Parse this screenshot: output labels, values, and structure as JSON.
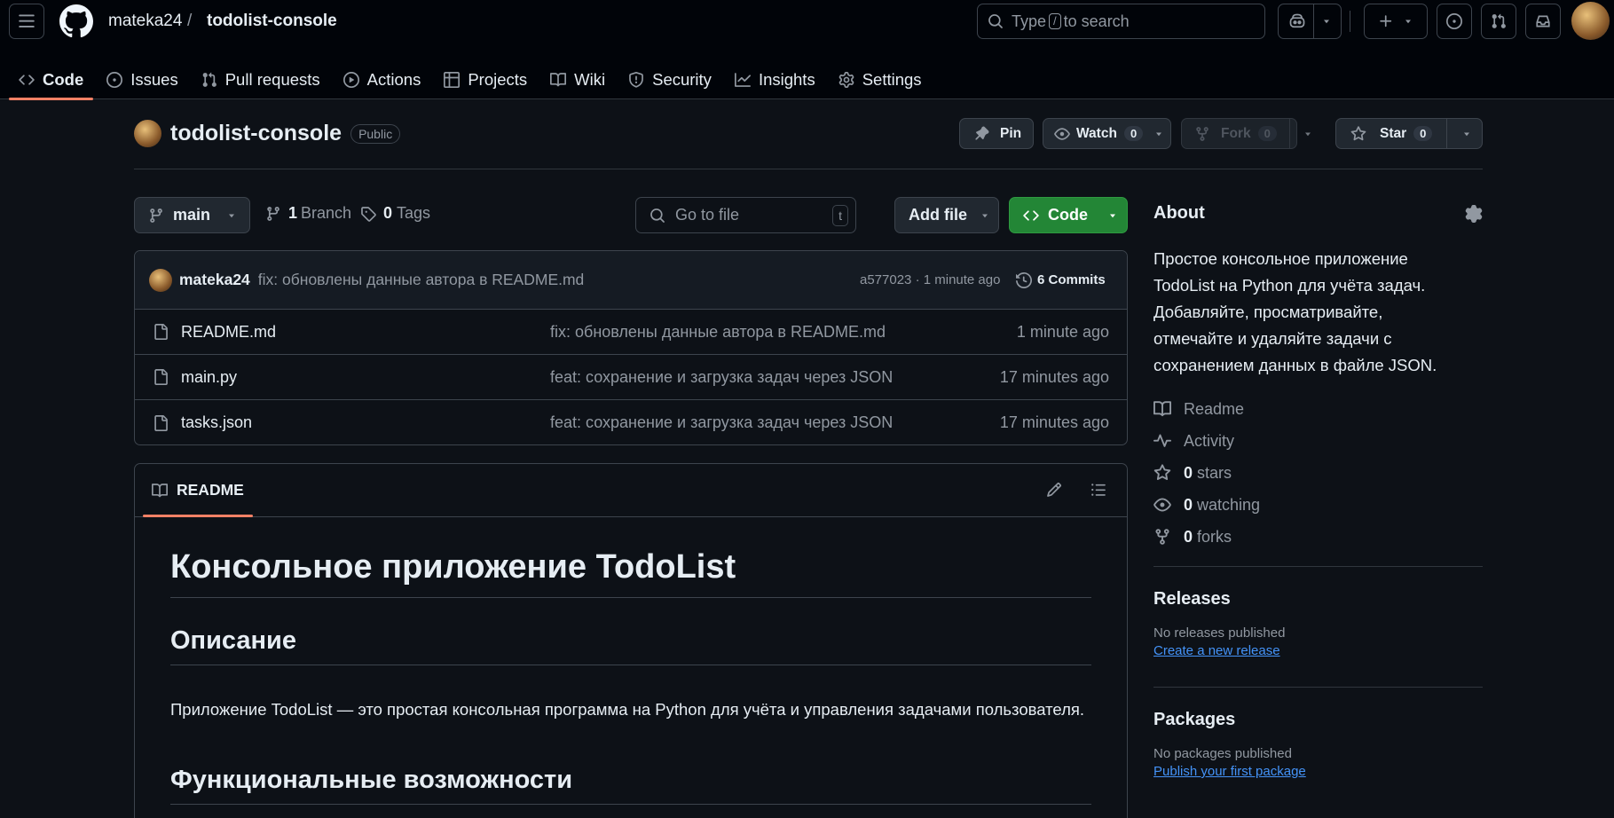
{
  "header": {
    "owner": "mateka24",
    "separator": "/",
    "repo": "todolist-console",
    "search_placeholder_prefix": "Type",
    "search_key": "/",
    "search_placeholder_suffix": "to search"
  },
  "tabs": [
    {
      "label": "Code",
      "icon": "code-icon"
    },
    {
      "label": "Issues",
      "icon": "issue-icon"
    },
    {
      "label": "Pull requests",
      "icon": "pull-request-icon"
    },
    {
      "label": "Actions",
      "icon": "play-icon"
    },
    {
      "label": "Projects",
      "icon": "table-icon"
    },
    {
      "label": "Wiki",
      "icon": "book-icon"
    },
    {
      "label": "Security",
      "icon": "shield-icon"
    },
    {
      "label": "Insights",
      "icon": "graph-icon"
    },
    {
      "label": "Settings",
      "icon": "gear-icon"
    }
  ],
  "repo": {
    "name": "todolist-console",
    "visibility": "Public",
    "pin_label": "Pin",
    "watch_label": "Watch",
    "watch_count": "0",
    "fork_label": "Fork",
    "fork_count": "0",
    "star_label": "Star",
    "star_count": "0"
  },
  "branchbar": {
    "branch": "main",
    "branch_count": "1",
    "branch_label": "Branch",
    "tag_count": "0",
    "tag_label": "Tags",
    "goto_placeholder": "Go to file",
    "goto_key": "t",
    "add_file_label": "Add file",
    "code_label": "Code"
  },
  "commit": {
    "author": "mateka24",
    "message": "fix: обновлены данные автора в README.md",
    "hash_time": "a577023 · 1 minute ago",
    "commits_label": "6 Commits"
  },
  "files": [
    {
      "name": "README.md",
      "message": "fix: обновлены данные автора в README.md",
      "time": "1 minute ago"
    },
    {
      "name": "main.py",
      "message": "feat: сохранение и загрузка задач через JSON",
      "time": "17 minutes ago"
    },
    {
      "name": "tasks.json",
      "message": "feat: сохранение и загрузка задач через JSON",
      "time": "17 minutes ago"
    }
  ],
  "readme": {
    "tab_label": "README",
    "h1": "Консольное приложение TodoList",
    "h2_description": "Описание",
    "description": "Приложение TodoList — это простая консольная программа на Python для учёта и управления задачами пользователя.",
    "h2_features": "Функциональные возможности"
  },
  "about": {
    "title": "About",
    "description": "Простое консольное приложение TodoList на Python для учёта задач. Добавляйте, просматривайте, отмечайте и удаляйте задачи с сохранением данных в файле JSON.",
    "readme_label": "Readme",
    "activity_label": "Activity",
    "stars_count": "0",
    "stars_label": "stars",
    "watching_count": "0",
    "watching_label": "watching",
    "forks_count": "0",
    "forks_label": "forks"
  },
  "releases": {
    "title": "Releases",
    "empty": "No releases published",
    "link": "Create a new release"
  },
  "packages": {
    "title": "Packages",
    "empty": "No packages published",
    "link": "Publish your first package"
  },
  "colors": {
    "background": "#0d1117",
    "header": "#010409",
    "border": "#3d444d",
    "accent_tab": "#f78166",
    "code_button": "#238636",
    "link": "#4493f8"
  }
}
